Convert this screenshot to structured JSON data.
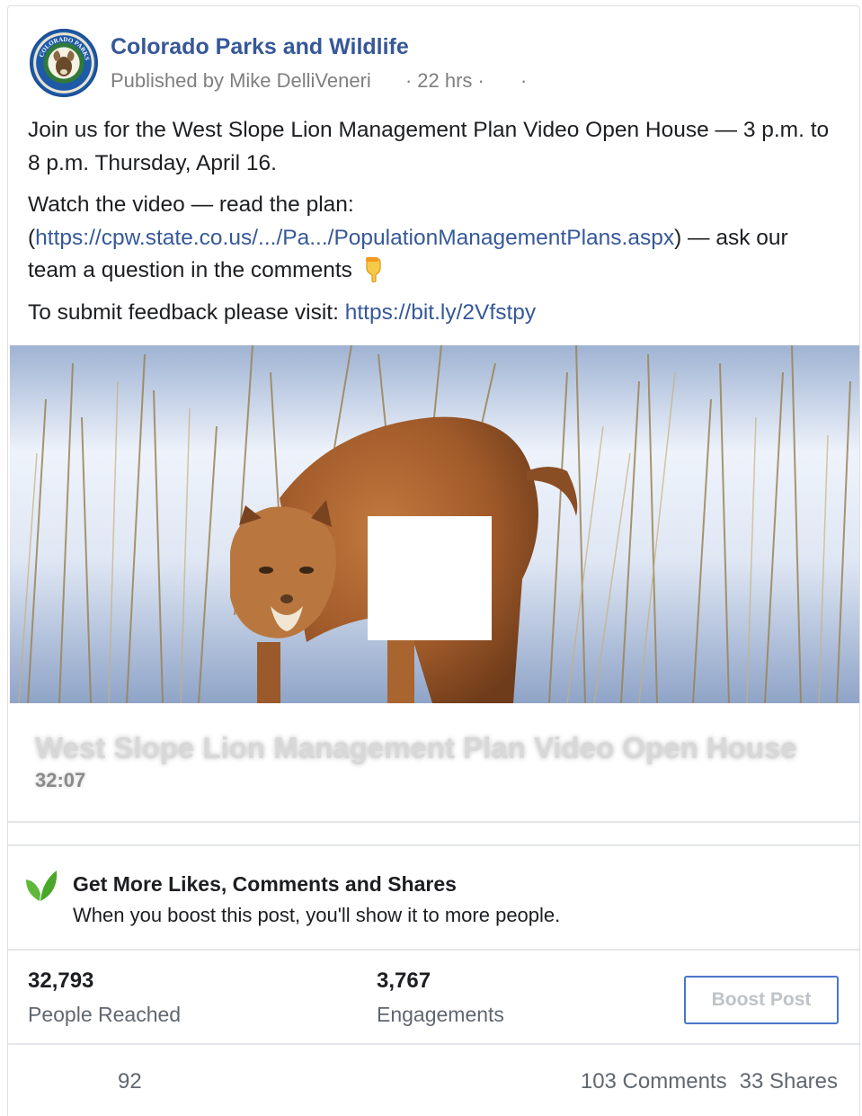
{
  "post": {
    "page_name": "Colorado Parks and Wildlife",
    "published_by": "Published by Mike DelliVeneri",
    "time": "22 hrs",
    "avatar_logo_text": "COLORADO PARKS & WILDLIFE",
    "text": {
      "line1": "Join us for the West Slope Lion Management Plan Video Open House — 3 p.m. to 8 p.m. Thursday, April 16.",
      "watch_prefix": "Watch the video — read the plan: (",
      "plan_link": "https://cpw.state.co.us/.../Pa.../PopulationManagementPlans.aspx",
      "watch_suffix": ") — ask our team a question in the comments",
      "feedback_prefix": "To submit feedback please visit: ",
      "feedback_link": "https://bit.ly/2Vfstpy"
    }
  },
  "video": {
    "title": "West Slope Lion Management Plan Video Open House",
    "duration": "32:07"
  },
  "promo": {
    "title": "Get More Likes, Comments and Shares",
    "subtitle": "When you boost this post, you'll show it to more people."
  },
  "stats": {
    "people_reached_value": "32,793",
    "people_reached_label": "People Reached",
    "engagements_value": "3,767",
    "engagements_label": "Engagements",
    "boost_button": "Boost Post"
  },
  "reactions": {
    "count": "92",
    "comments": "103 Comments",
    "shares": "33 Shares"
  },
  "colors": {
    "link": "#365899",
    "boost_border": "#4a76c9",
    "leaf": "#5fb83a"
  }
}
